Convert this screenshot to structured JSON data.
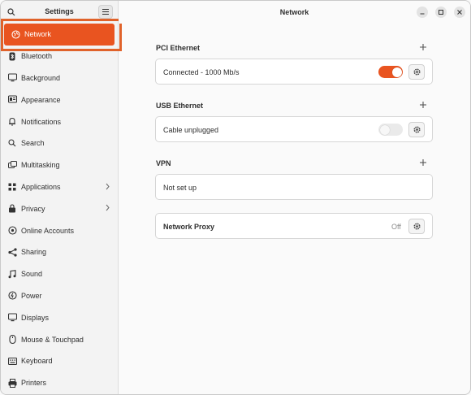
{
  "sidebar": {
    "title": "Settings",
    "items": [
      {
        "label": "Network",
        "icon": "globe-icon",
        "active": true
      },
      {
        "label": "Bluetooth",
        "icon": "bluetooth-icon"
      },
      {
        "label": "Background",
        "icon": "monitor-icon"
      },
      {
        "label": "Appearance",
        "icon": "appearance-icon"
      },
      {
        "label": "Notifications",
        "icon": "bell-icon"
      },
      {
        "label": "Search",
        "icon": "search-icon"
      },
      {
        "label": "Multitasking",
        "icon": "multitasking-icon"
      },
      {
        "label": "Applications",
        "icon": "apps-icon",
        "chevron": true
      },
      {
        "label": "Privacy",
        "icon": "lock-icon",
        "chevron": true
      },
      {
        "label": "Online Accounts",
        "icon": "cloud-icon"
      },
      {
        "label": "Sharing",
        "icon": "share-icon"
      },
      {
        "label": "Sound",
        "icon": "music-note-icon"
      },
      {
        "label": "Power",
        "icon": "power-icon"
      },
      {
        "label": "Displays",
        "icon": "display-icon"
      },
      {
        "label": "Mouse & Touchpad",
        "icon": "mouse-icon"
      },
      {
        "label": "Keyboard",
        "icon": "keyboard-icon"
      },
      {
        "label": "Printers",
        "icon": "printer-icon"
      }
    ]
  },
  "header": {
    "title": "Network"
  },
  "sections": {
    "pci": {
      "title": "PCI Ethernet",
      "status": "Connected - 1000 Mb/s",
      "enabled": true
    },
    "usb": {
      "title": "USB Ethernet",
      "status": "Cable unplugged",
      "enabled": false
    },
    "vpn": {
      "title": "VPN",
      "status": "Not set up"
    },
    "proxy": {
      "label": "Network Proxy",
      "state": "Off"
    }
  },
  "colors": {
    "accent": "#e95420",
    "highlight": "#e0622a"
  }
}
